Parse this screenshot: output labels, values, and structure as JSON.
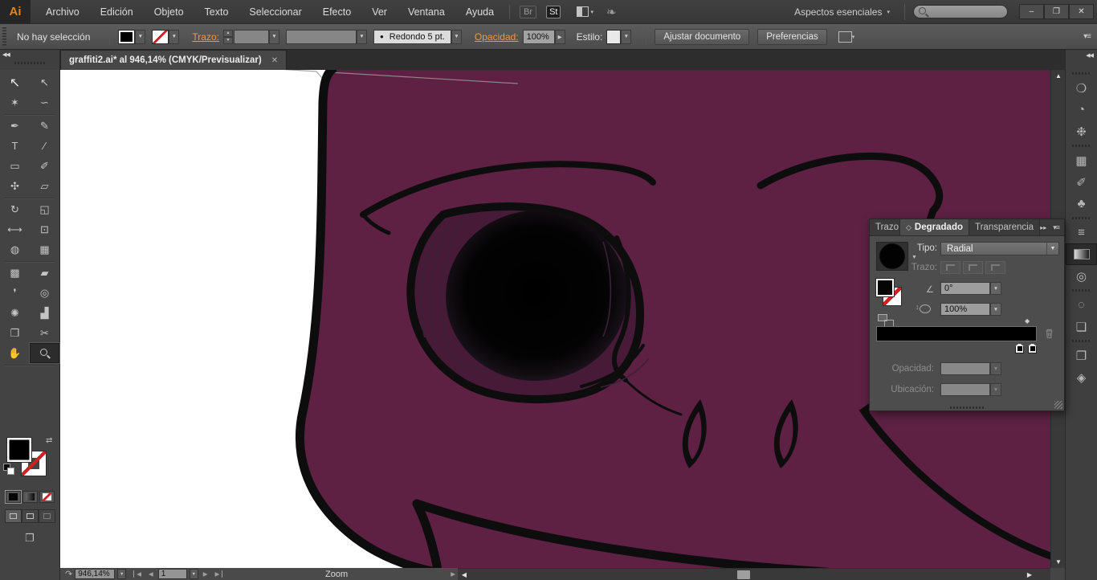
{
  "window": {
    "minimize": "–",
    "restore": "❐",
    "close": "✕"
  },
  "menu": {
    "logo": "Ai",
    "items": [
      "Archivo",
      "Edición",
      "Objeto",
      "Texto",
      "Seleccionar",
      "Efecto",
      "Ver",
      "Ventana",
      "Ayuda"
    ],
    "bridge": "Br",
    "stock": "St",
    "workspace": "Aspectos esenciales",
    "workspace_arrow": "▾",
    "search_value": ""
  },
  "control": {
    "selection_status": "No hay selección",
    "stroke_label": "Trazo:",
    "brush_dot": "●",
    "brush_name": "Redondo 5 pt.",
    "opacity_label": "Opacidad:",
    "opacity_value": "100%",
    "style_label": "Estilo:",
    "fit_btn": "Ajustar documento",
    "prefs_btn": "Preferencias",
    "panel_menu_glyph": "▾≡"
  },
  "tab": {
    "title": "graffiti2.ai* al 946,14% (CMYK/Previsualizar)",
    "close": "✕"
  },
  "toolbar": {
    "collapse_glyph": "◀◀",
    "tools": [
      {
        "name": "selection-tool",
        "glyph": "↖",
        "big": true
      },
      {
        "name": "direct-selection-tool",
        "glyph": "↖"
      },
      {
        "name": "magic-wand-tool",
        "glyph": "✶"
      },
      {
        "name": "lasso-tool",
        "glyph": "∽"
      },
      {
        "name": "pen-tool",
        "glyph": "✒"
      },
      {
        "name": "pencil-tool",
        "glyph": "✎"
      },
      {
        "name": "type-tool",
        "glyph": "T"
      },
      {
        "name": "line-segment-tool",
        "glyph": "∕"
      },
      {
        "name": "rectangle-tool",
        "glyph": "▭"
      },
      {
        "name": "paintbrush-tool",
        "glyph": "✐"
      },
      {
        "name": "blob-brush-tool",
        "glyph": "✣"
      },
      {
        "name": "eraser-tool",
        "glyph": "▱"
      },
      {
        "name": "rotate-tool",
        "glyph": "↻"
      },
      {
        "name": "scale-tool",
        "glyph": "◱"
      },
      {
        "name": "width-tool",
        "glyph": "⟷"
      },
      {
        "name": "free-transform-tool",
        "glyph": "⊡"
      },
      {
        "name": "shape-builder-tool",
        "glyph": "◍"
      },
      {
        "name": "perspective-grid-tool",
        "glyph": "▦"
      },
      {
        "name": "mesh-tool",
        "glyph": "▩"
      },
      {
        "name": "gradient-tool",
        "glyph": "▰"
      },
      {
        "name": "eyedropper-tool",
        "glyph": "❜"
      },
      {
        "name": "blend-tool",
        "glyph": "◎"
      },
      {
        "name": "symbol-sprayer-tool",
        "glyph": "✺"
      },
      {
        "name": "column-graph-tool",
        "glyph": "▟"
      },
      {
        "name": "artboard-tool",
        "glyph": "❒"
      },
      {
        "name": "slice-tool",
        "glyph": "✂"
      },
      {
        "name": "hand-tool",
        "glyph": "✋"
      },
      {
        "name": "zoom-tool",
        "glyph": "",
        "active": true
      }
    ]
  },
  "panel": {
    "tabs": {
      "stroke": "Trazo",
      "gradient": "Degradado",
      "transparency": "Transparencia"
    },
    "collapse_glyph": "◇",
    "expand_glyph": "▸▸",
    "menu_glyph": "▾≡",
    "type_label": "Tipo:",
    "type_value": "Radial",
    "stroke_label": "Trazo:",
    "angle_glyph": "∠",
    "angle_value": "0°",
    "aspect_value": "100%",
    "opacity_label": "Opacidad:",
    "location_label": "Ubicación:"
  },
  "dock": {
    "collapse_glyph": "◀◀",
    "icons": [
      {
        "name": "color-panel-icon",
        "glyph": "❍"
      },
      {
        "name": "color-guide-icon",
        "glyph": "◔"
      },
      {
        "name": "edit-colors-icon",
        "glyph": "❉"
      },
      {
        "name": "swatches-icon",
        "glyph": "▦"
      },
      {
        "name": "brushes-icon",
        "glyph": "✐"
      },
      {
        "name": "symbols-icon",
        "glyph": "♣"
      },
      {
        "name": "stroke-panel-icon",
        "glyph": "≡"
      },
      {
        "name": "gradient-panel-icon",
        "glyph": "",
        "active": true
      },
      {
        "name": "transparency-panel-icon",
        "glyph": "◎"
      },
      {
        "name": "appearance-panel-icon",
        "glyph": "◌"
      },
      {
        "name": "graphic-styles-icon",
        "glyph": "❏"
      },
      {
        "name": "artboards-panel-icon",
        "glyph": "❐"
      },
      {
        "name": "layers-panel-icon",
        "glyph": "◈"
      }
    ]
  },
  "status": {
    "history_glyph": "↷",
    "zoom_value": "946,14%",
    "nav_first": "◀",
    "nav_prev": "◀",
    "artboard_value": "1",
    "nav_next": "▶",
    "nav_last": "▶",
    "tool_name": "Zoom",
    "expand_glyph": "▶"
  },
  "scroll": {
    "up": "▲",
    "down": "▼",
    "left": "◀",
    "right": "▶"
  },
  "colors": {
    "face": "#5E2144",
    "eye_socket": "#471B38",
    "outline": "#0D0D0D",
    "accent_line": "#3B2036",
    "artboard": "#FFFFFF"
  }
}
